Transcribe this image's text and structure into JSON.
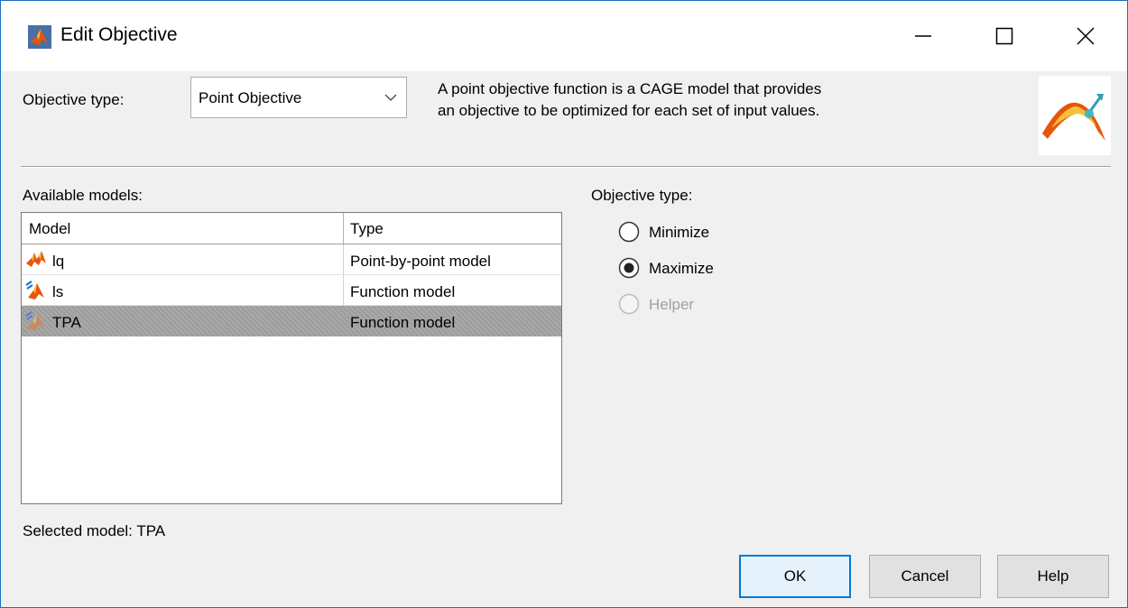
{
  "window": {
    "title": "Edit Objective",
    "controls": {
      "minimize": "minimize",
      "maximize": "maximize",
      "close": "close"
    }
  },
  "header": {
    "objective_type_label": "Objective type:",
    "objective_type_value": "Point Objective",
    "description_line1": "A point objective function is a CAGE model that provides",
    "description_line2": "an objective to be optimized for each set of input values."
  },
  "models": {
    "label": "Available models:",
    "columns": [
      "Model",
      "Type"
    ],
    "rows": [
      {
        "name": "lq",
        "type": "Point-by-point model",
        "icon": "point-by-point-model-icon",
        "selected": false
      },
      {
        "name": "ls",
        "type": "Function model",
        "icon": "function-model-icon",
        "selected": false
      },
      {
        "name": "TPA",
        "type": "Function model",
        "icon": "function-model-icon",
        "selected": true
      }
    ],
    "selected_text": "Selected model: TPA"
  },
  "objective": {
    "label": "Objective type:",
    "options": [
      {
        "label": "Minimize",
        "checked": false,
        "enabled": true
      },
      {
        "label": "Maximize",
        "checked": true,
        "enabled": true
      },
      {
        "label": "Helper",
        "checked": false,
        "enabled": false
      }
    ]
  },
  "buttons": {
    "ok": "OK",
    "cancel": "Cancel",
    "help": "Help"
  },
  "colors": {
    "accent": "#0078d7",
    "selection": "#a2a2a2",
    "matlab_orange": "#e8550a"
  }
}
